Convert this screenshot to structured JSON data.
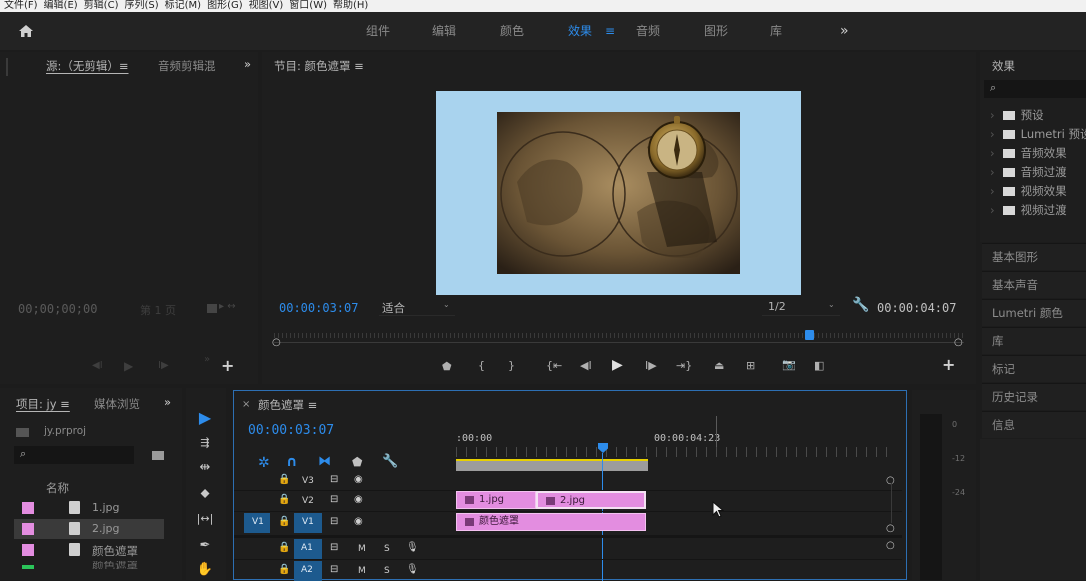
{
  "menu": [
    "文件(F)",
    "编辑(E)",
    "剪辑(C)",
    "序列(S)",
    "标记(M)",
    "图形(G)",
    "视图(V)",
    "窗口(W)",
    "帮助(H)"
  ],
  "workspaces": [
    "组件",
    "编辑",
    "颜色",
    "效果",
    "≡",
    "音频",
    "图形",
    "库"
  ],
  "workspace_active": "效果",
  "workspace_more": "»",
  "source": {
    "tab": "源:（无剪辑）≡",
    "tab2": "音频剪辑混",
    "more": "»",
    "timecode": "00;00;00;00",
    "page": "第 1 页"
  },
  "program": {
    "tab": "节目: 颜色遮罩 ≡",
    "timecode": "00:00:03:07",
    "fit": "适合",
    "resolution": "1/2",
    "duration": "00:00:04:07",
    "playhead_fraction": 0.775
  },
  "project": {
    "tab": "项目: jy ≡",
    "tab2": "媒体浏览",
    "more": "»",
    "file": "jy.prproj",
    "name_header": "名称",
    "items": [
      "1.jpg",
      "2.jpg",
      "颜色遮罩",
      "颜色遮罩"
    ]
  },
  "timeline": {
    "close": "×",
    "tab": "颜色遮罩 ≡",
    "timecode": "00:00:03:07",
    "ruler": [
      ":00:00",
      "00:00:04:23"
    ],
    "tracks": [
      "V3",
      "V2",
      "V1",
      "A1",
      "A2"
    ],
    "v1_source": "V1",
    "clips": {
      "c1": "1.jpg",
      "c2": "2.jpg",
      "c3": "颜色遮罩"
    },
    "audio_btns": [
      "M",
      "S"
    ],
    "eye_btn": "👁"
  },
  "meter": {
    "labels": [
      "0",
      "-12",
      "-24"
    ],
    "top": "0"
  },
  "effects": {
    "title": "效果",
    "tree": [
      "预设",
      "Lumetri 预设",
      "音频效果",
      "音频过渡",
      "视频效果",
      "视频过渡"
    ],
    "panels": [
      "基本图形",
      "基本声音",
      "Lumetri 颜色",
      "库",
      "标记",
      "历史记录",
      "信息"
    ]
  }
}
